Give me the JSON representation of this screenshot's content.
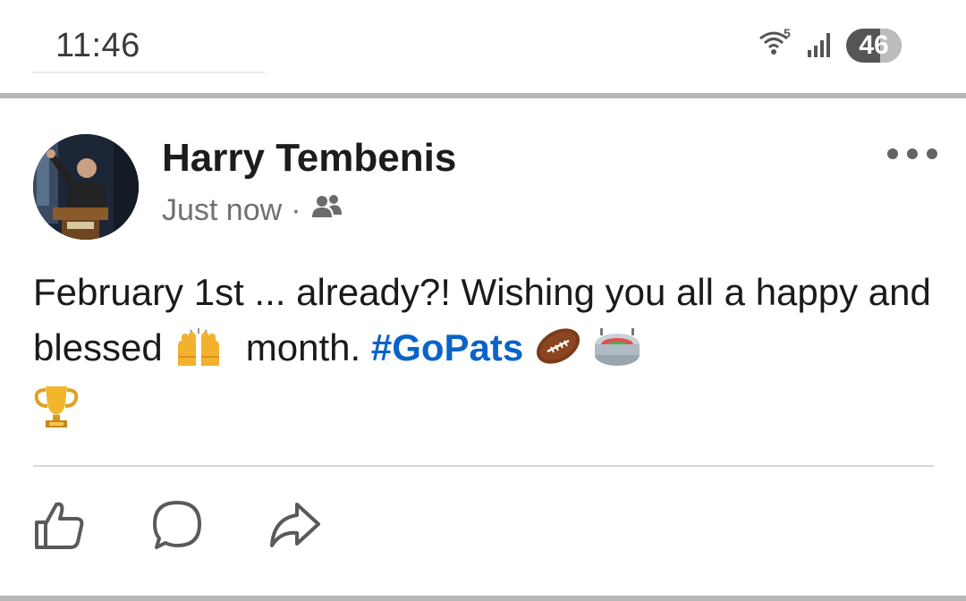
{
  "status_bar": {
    "time": "11:46",
    "wifi_label": "5",
    "battery_level": "46",
    "icons": [
      "wifi-icon",
      "signal-icon",
      "battery-icon"
    ]
  },
  "post": {
    "author": "Harry Tembenis",
    "timestamp": "Just now",
    "separator": "·",
    "audience_icon": "friends-icon",
    "text_part1": "February 1st ... already?! Wishing you all a happy and blessed",
    "text_part2": "month.",
    "hashtag": "#GoPats",
    "emojis": [
      "raising-hands-icon",
      "football-icon",
      "stadium-icon",
      "trophy-icon"
    ],
    "actions": [
      "like",
      "comment",
      "share"
    ]
  },
  "colors": {
    "hashtag": "#0a64c8",
    "text": "#1a1a1a",
    "meta": "#707070",
    "divider": "#b7b7b7"
  }
}
